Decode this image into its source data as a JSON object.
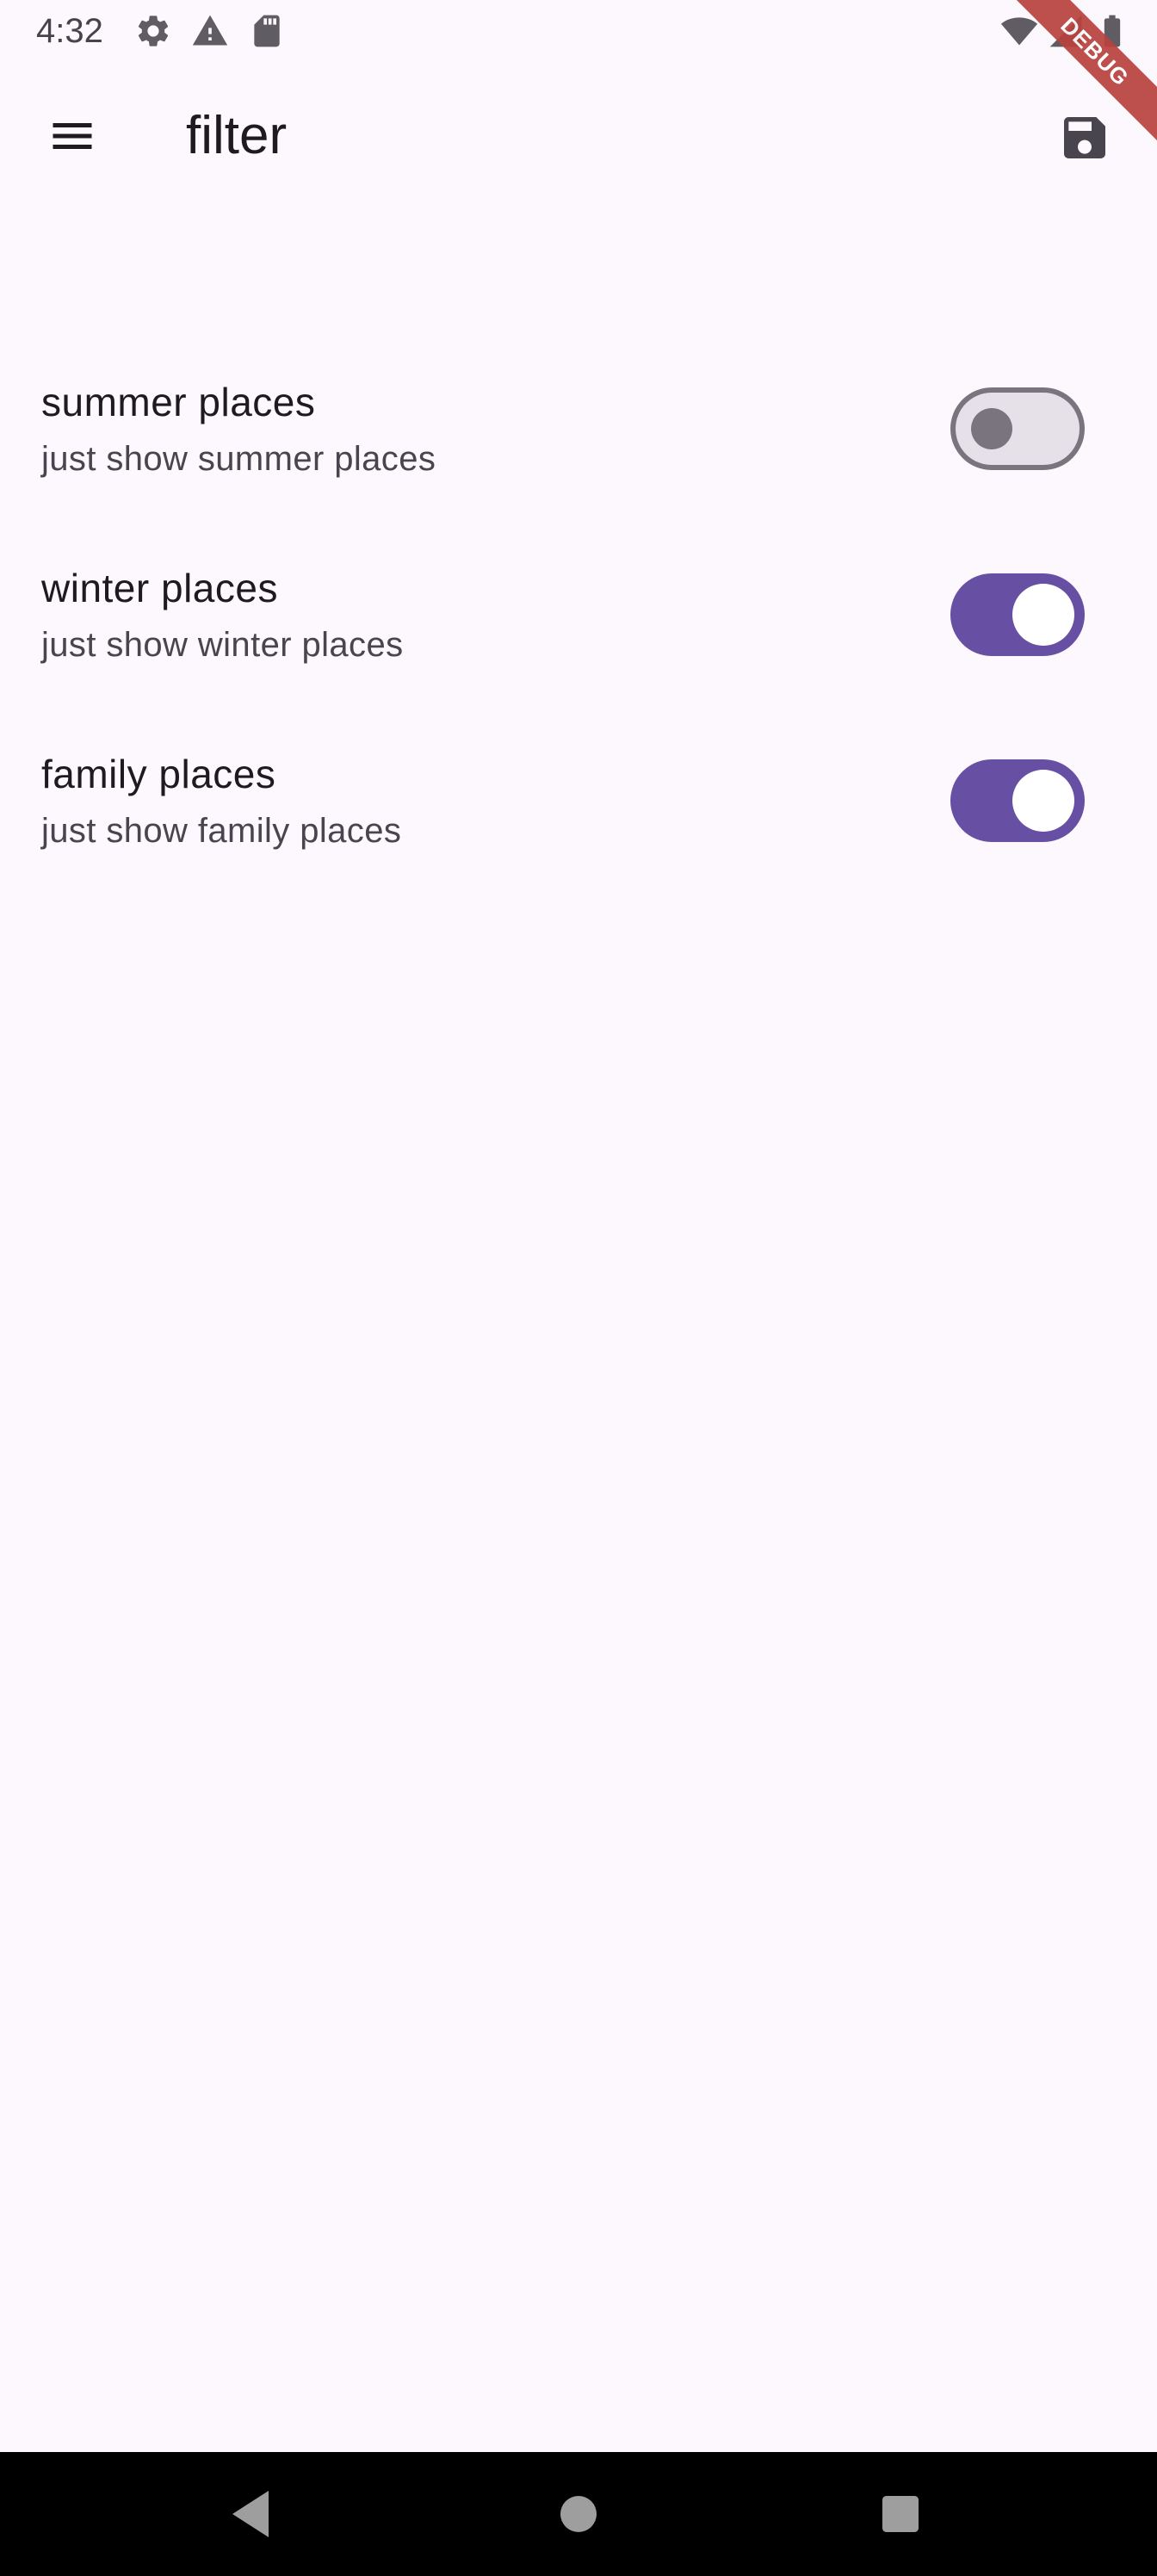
{
  "status_bar": {
    "time": "4:32",
    "icons": [
      "settings-icon",
      "warning-icon",
      "sd-card-icon",
      "wifi-icon",
      "signal-icon",
      "battery-icon"
    ]
  },
  "debug_banner": {
    "label": "DEBUG",
    "color": "#b8413f"
  },
  "app_bar": {
    "title": "filter",
    "leading_icon": "menu-icon",
    "action_icon": "save-icon"
  },
  "filters": [
    {
      "title": "summer places",
      "subtitle": "just show summer places",
      "enabled": false
    },
    {
      "title": "winter places",
      "subtitle": "just show winter places",
      "enabled": true
    },
    {
      "title": "family places",
      "subtitle": "just show family places",
      "enabled": true
    }
  ],
  "nav_bar": {
    "buttons": [
      "back-icon",
      "home-icon",
      "recents-icon"
    ]
  },
  "colors": {
    "background": "#fdf7fe",
    "primary": "#6750a4",
    "switch_off_track": "#e6e0e9",
    "switch_off_outline": "#79747e",
    "text_primary": "#1d1b20",
    "text_secondary": "#49454f"
  }
}
